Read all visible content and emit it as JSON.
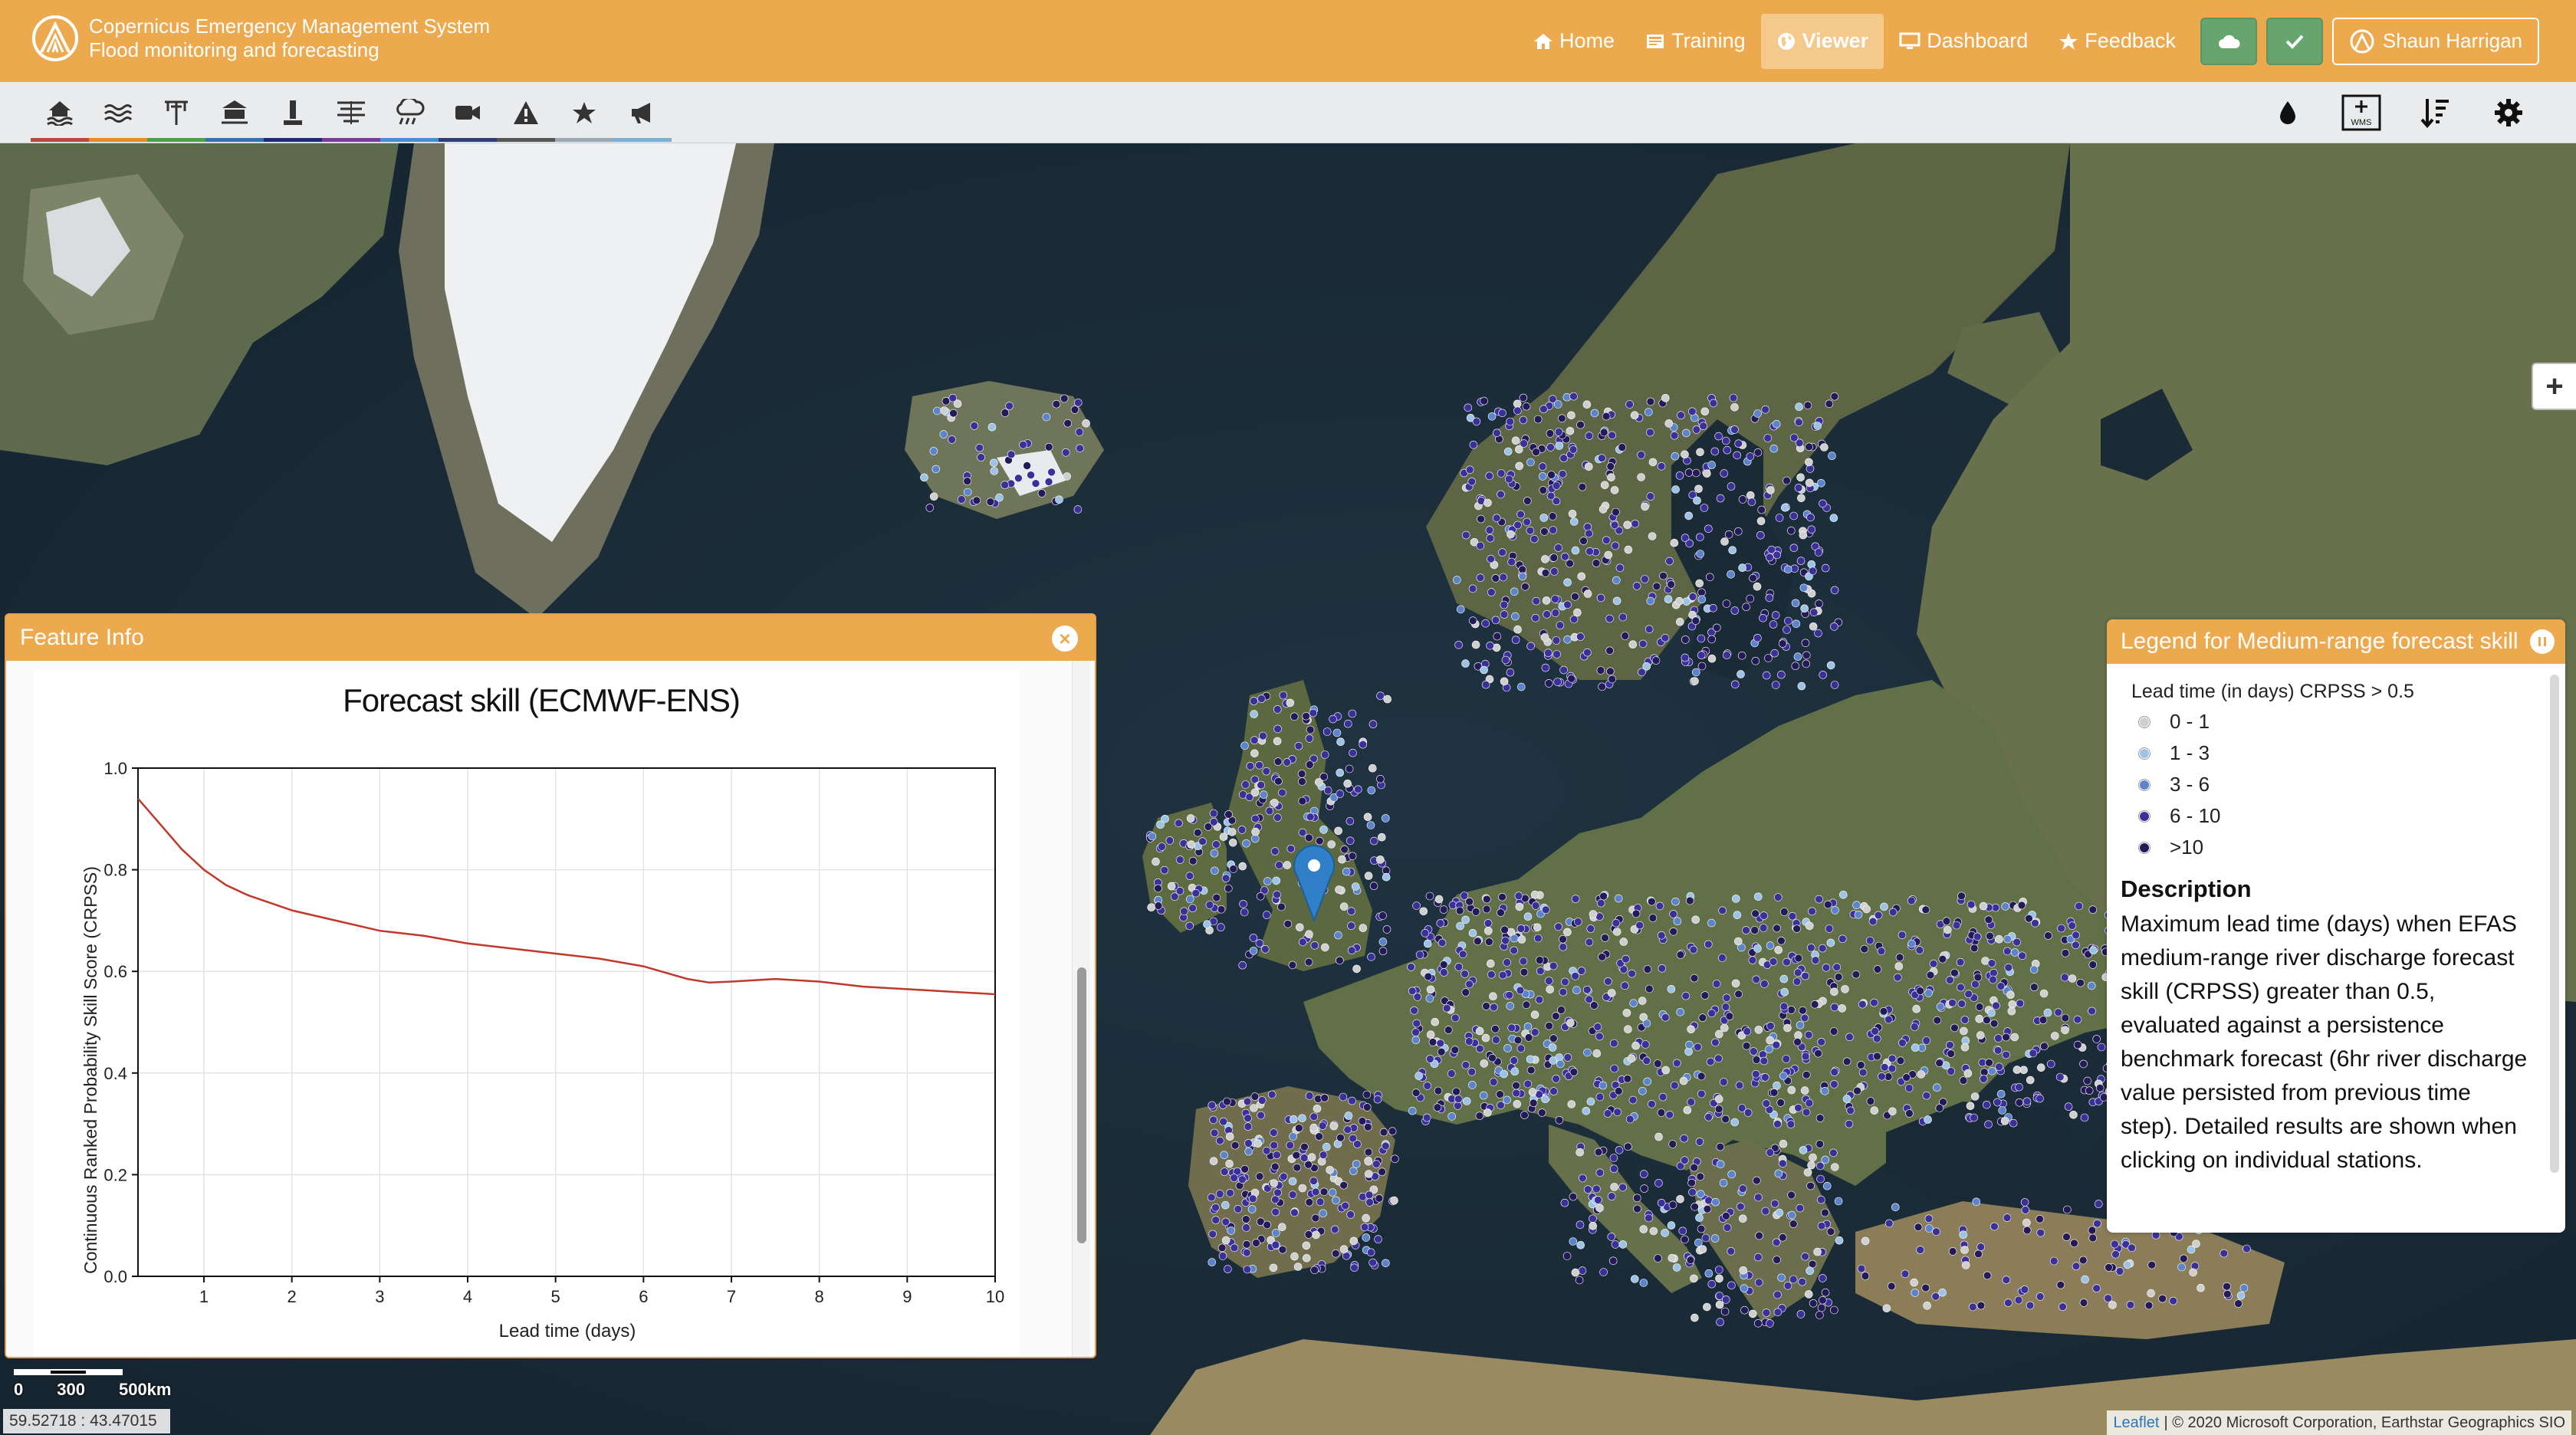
{
  "header": {
    "title_line1": "Copernicus Emergency Management System",
    "title_line2": "Flood monitoring and forecasting",
    "nav": [
      {
        "label": "Home",
        "icon": "home-icon"
      },
      {
        "label": "Training",
        "icon": "training-icon"
      },
      {
        "label": "Viewer",
        "icon": "globe-icon",
        "active": true
      },
      {
        "label": "Dashboard",
        "icon": "monitor-icon"
      },
      {
        "label": "Feedback",
        "icon": "star-icon"
      }
    ],
    "user_name": "Shaun Harrigan"
  },
  "toolbar": {
    "layer_icons": [
      "flood-icon",
      "wave-icon",
      "river-station-icon",
      "reservoir-icon",
      "gauge-icon",
      "hydrology-icon",
      "rainfall-icon",
      "camera-icon",
      "warning-icon",
      "star-icon",
      "announcement-icon"
    ],
    "layer_colors": [
      "#b84a3b",
      "#e58b2b",
      "#46a447",
      "#2f72b8",
      "#1d2a7d",
      "#7a3a9c",
      "#3f8fd6",
      "#2d3e78",
      "#555555",
      "#9aa7b5",
      "#7ab0d6"
    ],
    "right_icons": [
      "water-drop-icon",
      "wms-add-icon",
      "sort-layers-icon",
      "settings-icon"
    ],
    "wms_label": "WMS"
  },
  "feature_info": {
    "title": "Feature Info",
    "chart_data": {
      "type": "line",
      "title": "Forecast skill (ECMWF-ENS)",
      "xlabel": "Lead time (days)",
      "ylabel": "Continuous Ranked Probability Skill Score (CRPSS)",
      "xlim": [
        0.25,
        10
      ],
      "ylim": [
        0,
        1
      ],
      "xticks": [
        1,
        2,
        3,
        4,
        5,
        6,
        7,
        8,
        9,
        10
      ],
      "yticks": [
        0.0,
        0.2,
        0.4,
        0.6,
        0.8,
        1.0
      ],
      "grid": true,
      "series": [
        {
          "color": "#c0392b",
          "x": [
            0.25,
            0.5,
            0.75,
            1,
            1.25,
            1.5,
            2,
            2.5,
            3,
            3.5,
            4,
            4.5,
            5,
            5.5,
            6,
            6.5,
            6.75,
            7,
            7.5,
            8,
            8.5,
            9,
            9.5,
            10
          ],
          "y": [
            0.94,
            0.89,
            0.84,
            0.8,
            0.77,
            0.75,
            0.72,
            0.7,
            0.68,
            0.67,
            0.655,
            0.645,
            0.635,
            0.625,
            0.61,
            0.585,
            0.578,
            0.58,
            0.585,
            0.58,
            0.57,
            0.565,
            0.56,
            0.555
          ]
        }
      ]
    }
  },
  "legend": {
    "title": "Legend for Medium-range forecast skill",
    "lead_title": "Lead time (in days) CRPSS > 0.5",
    "classes": [
      {
        "label": "0 - 1",
        "color": "#cfcfcf"
      },
      {
        "label": "1 - 3",
        "color": "#9cc3e6"
      },
      {
        "label": "3 - 6",
        "color": "#5b84cc"
      },
      {
        "label": "6 - 10",
        "color": "#3b2f9a"
      },
      {
        "label": ">10",
        "color": "#241a5a"
      }
    ],
    "description_title": "Description",
    "description": "Maximum lead time (days) when EFAS medium-range river discharge forecast skill (CRPSS) greater than 0.5, evaluated against a persistence benchmark forecast (6hr river discharge value persisted from previous time step). Detailed results are shown when clicking on individual stations."
  },
  "map": {
    "scale_labels": [
      "0",
      "300",
      "500km"
    ],
    "coordinates": "59.52718 : 43.47015",
    "attribution_link": "Leaflet",
    "attribution_text": "| © 2020 Microsoft Corporation, Earthstar Geographics SIO",
    "zoom_in_label": "+"
  }
}
